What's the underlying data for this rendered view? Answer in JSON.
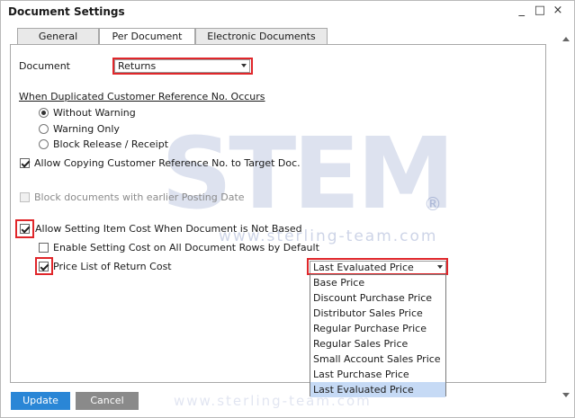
{
  "window": {
    "title": "Document Settings",
    "controls": {
      "minimize": "_",
      "maximize": "□",
      "close": "×"
    }
  },
  "tabs": [
    {
      "label": "General"
    },
    {
      "label": "Per Document"
    },
    {
      "label": "Electronic Documents"
    }
  ],
  "document": {
    "label": "Document",
    "value": "Returns"
  },
  "duplicated": {
    "heading": "When Duplicated Customer Reference No. Occurs",
    "options": [
      {
        "label": "Without Warning",
        "selected": true
      },
      {
        "label": "Warning Only",
        "selected": false
      },
      {
        "label": "Block Release / Receipt",
        "selected": false
      }
    ]
  },
  "checkboxes": {
    "allow_copying": {
      "label": "Allow Copying Customer Reference No. to Target Doc.",
      "checked": true
    },
    "block_docs": {
      "label": "Block documents with earlier Posting Date",
      "checked": false,
      "disabled": true
    },
    "allow_setting_cost": {
      "label": "Allow Setting Item Cost When Document is Not Based",
      "checked": true
    },
    "enable_setting_cost": {
      "label": "Enable Setting Cost on All Document Rows by Default",
      "checked": false
    },
    "price_list_return": {
      "label": "Price List of Return Cost",
      "checked": true
    }
  },
  "price_list": {
    "selected": "Last Evaluated Price",
    "options": [
      "Base Price",
      "Discount Purchase Price",
      "Distributor Sales Price",
      "Regular Purchase Price",
      "Regular Sales Price",
      "Small Account Sales Price",
      "Last Purchase Price",
      "Last Evaluated Price"
    ]
  },
  "buttons": {
    "update": "Update",
    "cancel": "Cancel"
  },
  "watermark": {
    "brand": "STEM",
    "registered": "®",
    "url": "www.sterling-team.com",
    "url_short": "www.sterling-team.com"
  },
  "colors": {
    "accent": "#2a86d6",
    "highlight": "#e0262a",
    "selection": "#c6daf5"
  }
}
